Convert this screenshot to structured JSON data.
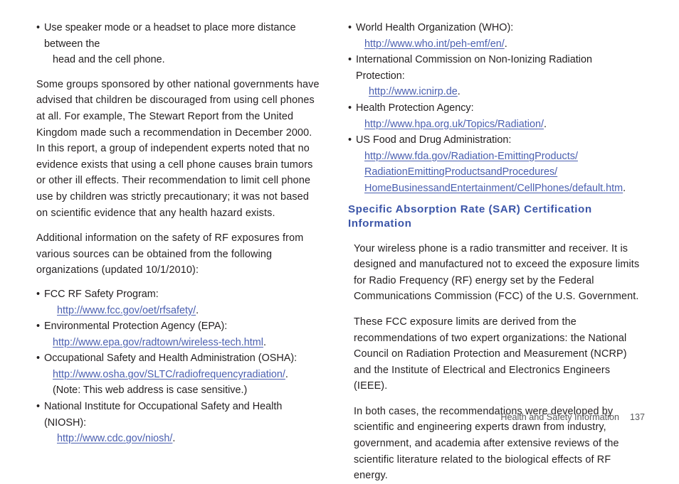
{
  "document": {
    "left_column": {
      "intro_bullet": {
        "marker": "•",
        "line1": "Use speaker mode or a headset to place more distance between the",
        "line2": "head and the cell phone."
      },
      "paragraph_stewart": "Some groups sponsored by other national governments have advised that children be discouraged from using cell phones at all. For example, The Stewart Report from the United Kingdom made such a recommendation in December 2000. In this report, a group of independent experts noted that no evidence exists that using a cell phone causes brain tumors or other ill effects. Their recommendation to limit cell phone use by children was strictly precautionary; it was not based on scientific evidence that any health hazard exists.",
      "paragraph_additional": "Additional information on the safety of RF exposures from various sources can be obtained from the following organizations (updated 10/1/2010):",
      "organizations": [
        {
          "marker": "•",
          "label": "FCC RF Safety Program:",
          "url": "http://www.fcc.gov/oet/rfsafety/",
          "trailing": ".",
          "indent": "deeper"
        },
        {
          "marker": "•",
          "label": "Environmental Protection Agency (EPA):",
          "url": "http://www.epa.gov/radtown/wireless-tech.html",
          "trailing": ".",
          "indent": "normal"
        },
        {
          "marker": "•",
          "label": "Occupational Safety and Health Administration (OSHA):",
          "url": "http://www.osha.gov/SLTC/radiofrequencyradiation/",
          "trailing": ".",
          "note": "(Note: This web address is case sensitive.)",
          "indent": "normal"
        },
        {
          "marker": "•",
          "label": "National Institute for Occupational Safety and Health (NIOSH):",
          "url": "http://www.cdc.gov/niosh/",
          "trailing": ".",
          "indent": "deeper"
        }
      ]
    },
    "right_column": {
      "organizations": [
        {
          "marker": "•",
          "label": "World Health Organization (WHO):",
          "url": "http://www.who.int/peh-emf/en/",
          "trailing": ".",
          "indent": "normal"
        },
        {
          "marker": "•",
          "label": "International Commission on Non-Ionizing Radiation Protection:",
          "url": "http://www.icnirp.de",
          "trailing": ".",
          "indent": "deeper"
        },
        {
          "marker": "•",
          "label": "Health Protection Agency:",
          "url": "http://www.hpa.org.uk/Topics/Radiation/",
          "trailing": ".",
          "indent": "normal"
        }
      ],
      "fda": {
        "marker": "•",
        "label": "US Food and Drug Administration:",
        "url_line1": "http://www.fda.gov/Radiation-EmittingProducts/",
        "url_line2": "RadiationEmittingProductsandProcedures/",
        "url_line3": "HomeBusinessandEntertainment/CellPhones/default.htm",
        "trailing": "."
      },
      "section_heading": "Specific Absorption Rate (SAR) Certification Information",
      "paragraphs": [
        "Your wireless phone is a radio transmitter and receiver. It is designed and manufactured not to exceed the exposure limits for Radio Frequency (RF) energy set by the Federal Communications Commission (FCC) of the U.S. Government.",
        "These FCC exposure limits are derived from the recommendations of two expert organizations: the National Council on Radiation Protection and Measurement (NCRP) and the Institute of Electrical and Electronics Engineers (IEEE).",
        "In both cases, the recommendations were developed by scientific and engineering experts drawn from industry, government, and academia after extensive reviews of the scientific literature related to the biological effects of RF energy."
      ]
    },
    "footer": {
      "title": "Health and Safety Information",
      "page_number": "137"
    },
    "colors": {
      "body_text": "#231f20",
      "link": "#4a5fb0",
      "heading": "#3b55a8",
      "footer_text": "#58595b",
      "background": "#ffffff"
    }
  }
}
